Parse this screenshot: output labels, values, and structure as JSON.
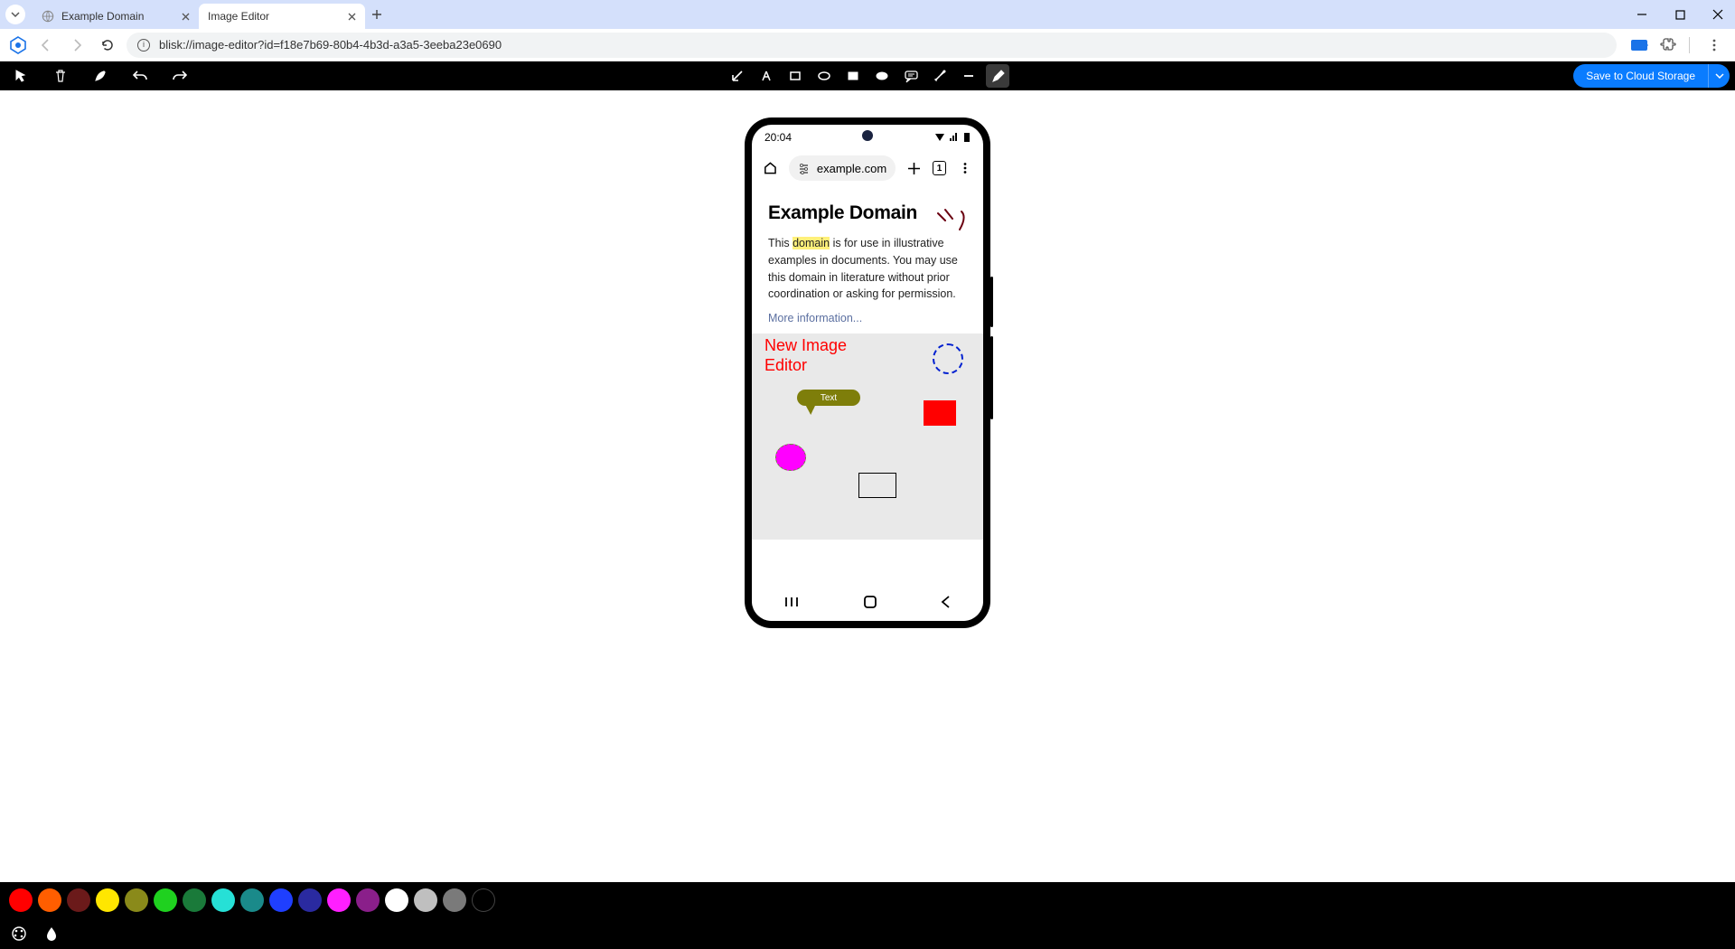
{
  "browser": {
    "tabs": [
      {
        "title": "Example Domain",
        "active": false
      },
      {
        "title": "Image Editor",
        "active": true
      }
    ],
    "url": "blisk://image-editor?id=f18e7b69-80b4-4b3d-a3a5-3eeba23e0690"
  },
  "editor_toolbar": {
    "tools": [
      "arrow-tool",
      "text-tool",
      "rect-outline-tool",
      "ellipse-outline-tool",
      "rect-fill-tool",
      "ellipse-fill-tool",
      "callout-tool",
      "highlighter-tool",
      "line-tool",
      "penbrush-tool"
    ],
    "active_tool": "penbrush-tool",
    "save_label": "Save to Cloud Storage"
  },
  "phone": {
    "time": "20:04",
    "address": "example.com",
    "tab_count": "1",
    "page_title": "Example Domain",
    "body_pre": "This ",
    "body_hl": "domain",
    "body_post": " is for use in illustrative examples in documents. You may use this domain in literature without prior coordination or asking for permission.",
    "link": "More information..."
  },
  "annotations": {
    "free_text": "New Image\nEditor",
    "callout_text": "Text"
  },
  "palette_colors": [
    "#ff0000",
    "#ff5e00",
    "#6b1a1a",
    "#ffe600",
    "#8a8a1a",
    "#1fd11f",
    "#1a7a3a",
    "#26e0d6",
    "#1a8a8a",
    "#1f3fff",
    "#2a2aa0",
    "#ff1fff",
    "#8a1f8a",
    "#ffffff",
    "#bfbfbf",
    "#7a7a7a",
    "#000000"
  ]
}
